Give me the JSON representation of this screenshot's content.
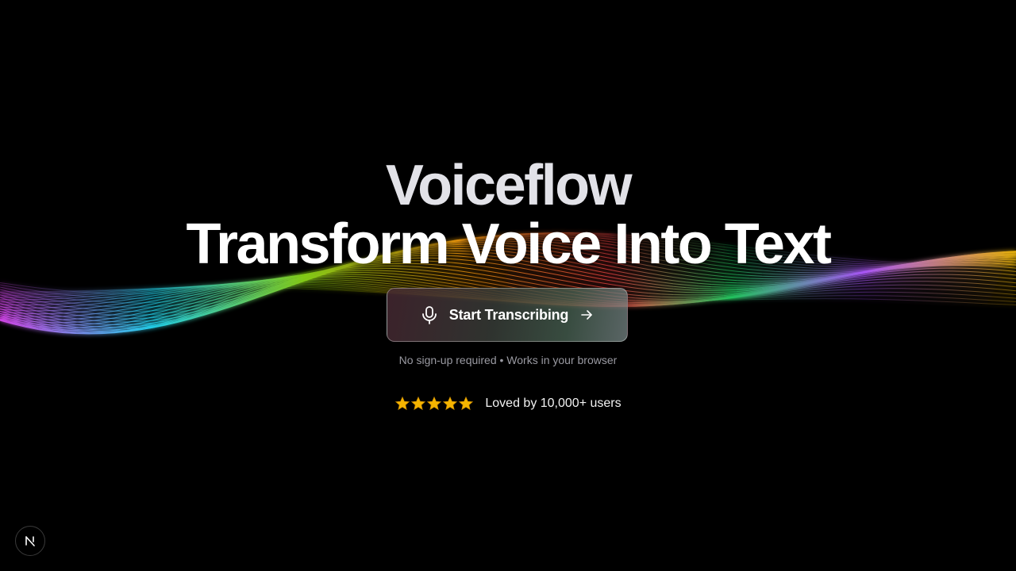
{
  "hero": {
    "title_line1": "Voiceflow",
    "title_line2": "Transform Voice Into Text",
    "cta_label": "Start Transcribing",
    "cta_icon_left": "microphone-icon",
    "cta_icon_right": "arrow-right-icon",
    "subtext": "No sign-up required • Works in your browser"
  },
  "rating": {
    "star_count": 5,
    "star_icon": "star-icon",
    "text": "Loved by 10,000+ users"
  },
  "badge": {
    "icon": "n-logo-icon"
  },
  "colors": {
    "background": "#000000",
    "title": "#ffffff",
    "subtext": "#9a9aa2",
    "star": "#f5b400"
  }
}
